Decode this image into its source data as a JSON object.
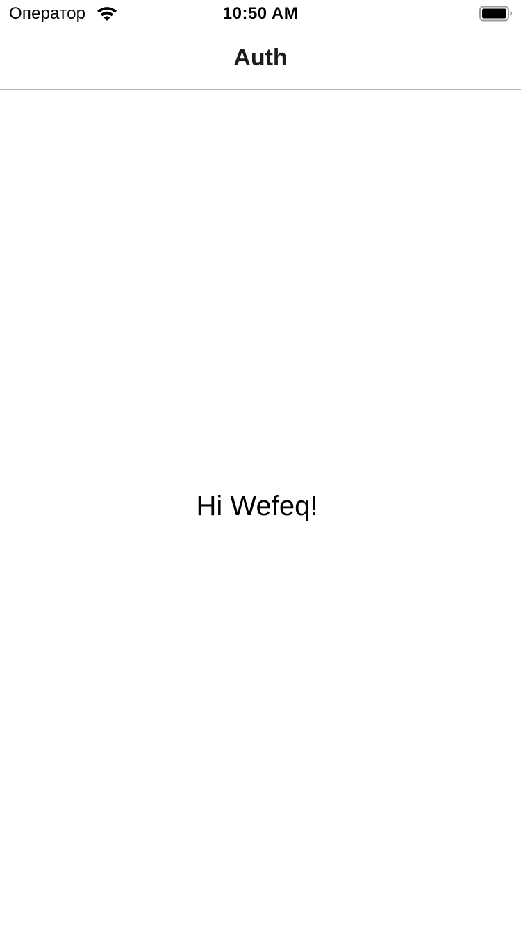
{
  "status_bar": {
    "carrier": "Оператор",
    "time": "10:50 AM",
    "wifi_icon": "wifi-icon",
    "battery_icon": "battery-icon"
  },
  "nav_bar": {
    "title": "Auth"
  },
  "main": {
    "greeting": "Hi Wefeq!"
  },
  "colors": {
    "background": "#ffffff",
    "text": "#000000",
    "divider": "#b2b2b2"
  }
}
